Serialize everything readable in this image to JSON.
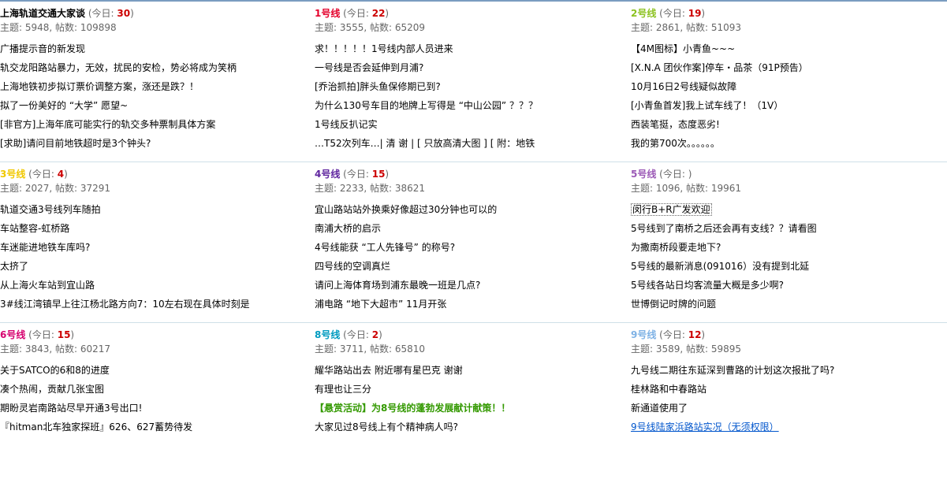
{
  "forums": [
    {
      "name": "上海轨道交通大家谈",
      "name_color": "#000000",
      "today_label": "今日: ",
      "today_count": "30",
      "stats": "主题: 5948, 帖数: 109898",
      "threads": [
        {
          "title": "广播提示音的新发现",
          "style": ""
        },
        {
          "title": "轨交龙阳路站暴力，无效，扰民的安检，势必将成为笑柄",
          "style": ""
        },
        {
          "title": "上海地铁初步拟订票价调整方案，涨还是跌？！",
          "style": ""
        },
        {
          "title": "拟了一份美好的 “大学” 愿望~",
          "style": ""
        },
        {
          "title": "[非官方]上海年底可能实行的轨交多种票制具体方案",
          "style": ""
        },
        {
          "title": "[求助]请问目前地铁超时是3个钟头?",
          "style": ""
        }
      ]
    },
    {
      "name": "1号线",
      "name_color": "#e4002b",
      "today_label": "今日: ",
      "today_count": "22",
      "stats": "主题: 3555, 帖数: 65209",
      "threads": [
        {
          "title": "求！！！！！1号线内部人员进来",
          "style": ""
        },
        {
          "title": "一号线是否会延伸到月浦?",
          "style": ""
        },
        {
          "title": "[乔治抓拍]胖头鱼保修期已到?",
          "style": ""
        },
        {
          "title": "为什么130号车目的地牌上写得是 “中山公园” ？？？",
          "style": ""
        },
        {
          "title": "1号线反扒记实",
          "style": ""
        },
        {
          "title": "…T52次列车…| 清 谢 | [ 只放高清大图 ] [ 附：地铁",
          "style": ""
        }
      ]
    },
    {
      "name": "2号线",
      "name_color": "#8cc220",
      "today_label": "今日: ",
      "today_count": "19",
      "stats": "主题: 2861, 帖数: 51093",
      "threads": [
        {
          "title": "【4M图标】小青鱼~~~",
          "style": ""
        },
        {
          "title": "[X.N.A 团伙作案]停车・品茶（91P预告）",
          "style": ""
        },
        {
          "title": "10月16日2号线疑似故障",
          "style": ""
        },
        {
          "title": "[小青鱼首发]我上试车线了！（1V）",
          "style": ""
        },
        {
          "title": "西装笔挺，态度恶劣!",
          "style": ""
        },
        {
          "title": "我的第700次。。。。。。",
          "style": ""
        }
      ]
    },
    {
      "name": "3号线",
      "name_color": "#f0c800",
      "today_label": "今日: ",
      "today_count": "4",
      "stats": "主题: 2027, 帖数: 37291",
      "threads": [
        {
          "title": "轨道交通3号线列车随拍",
          "style": ""
        },
        {
          "title": "车站整容-虹桥路",
          "style": ""
        },
        {
          "title": "车迷能进地铁车库吗?",
          "style": ""
        },
        {
          "title": "太挤了",
          "style": ""
        },
        {
          "title": "从上海火车站到宜山路",
          "style": ""
        },
        {
          "title": "3#线江湾镇早上往江杨北路方向7：10左右现在具体时刻是",
          "style": ""
        }
      ]
    },
    {
      "name": "4号线",
      "name_color": "#5f259f",
      "today_label": "今日: ",
      "today_count": "15",
      "stats": "主题: 2233, 帖数: 38621",
      "threads": [
        {
          "title": "宜山路站站外换乘好像超过30分钟也可以的",
          "style": ""
        },
        {
          "title": "南浦大桥的启示",
          "style": ""
        },
        {
          "title": "4号线能获 “工人先锋号” 的称号?",
          "style": ""
        },
        {
          "title": "四号线的空调真烂",
          "style": ""
        },
        {
          "title": "请问上海体育场到浦东最晚一班是几点?",
          "style": ""
        },
        {
          "title": "浦电路 “地下大超市” 11月开张",
          "style": ""
        }
      ]
    },
    {
      "name": "5号线",
      "name_color": "#9b59b6",
      "today_label": "今日: ",
      "today_count": "",
      "stats": "主题: 1096, 帖数: 19961",
      "threads": [
        {
          "title": "闵行B+R广发欢迎",
          "style": "boxed"
        },
        {
          "title": "5号线到了南桥之后还会再有支线？？请看图",
          "style": ""
        },
        {
          "title": "为撒南桥段要走地下?",
          "style": ""
        },
        {
          "title": "5号线的最新消息(091016）没有提到北延",
          "style": ""
        },
        {
          "title": "5号线各站日均客流量大概是多少啊?",
          "style": ""
        },
        {
          "title": "世博倒记时牌的问题",
          "style": ""
        }
      ]
    },
    {
      "name": "6号线",
      "name_color": "#d6006f",
      "today_label": "今日: ",
      "today_count": "15",
      "stats": "主题: 3843, 帖数: 60217",
      "threads": [
        {
          "title": "关于SATCO的6和8的进度",
          "style": ""
        },
        {
          "title": "凑个热闹，贡献几张宝图",
          "style": ""
        },
        {
          "title": "期盼灵岩南路站尽早开通3号出口!",
          "style": ""
        },
        {
          "title": "『hitman北车独家探班』626、627蓄势待发",
          "style": ""
        }
      ]
    },
    {
      "name": "8号线",
      "name_color": "#009bc0",
      "today_label": "今日: ",
      "today_count": "2",
      "stats": "主题: 3711, 帖数: 65810",
      "threads": [
        {
          "title": "耀华路站出去 附近哪有星巴克 谢谢",
          "style": ""
        },
        {
          "title": "有理也让三分",
          "style": ""
        },
        {
          "title": "【悬赏活动】为8号线的蓬勃发展献计献策！！",
          "style": "hl"
        },
        {
          "title": "大家见过8号线上有个精神病人吗?",
          "style": ""
        }
      ]
    },
    {
      "name": "9号线",
      "name_color": "#7fb2e5",
      "today_label": "今日: ",
      "today_count": "12",
      "stats": "主题: 3589, 帖数: 59895",
      "threads": [
        {
          "title": "九号线二期往东延深到曹路的计划这次报批了吗?",
          "style": ""
        },
        {
          "title": "桂林路和中春路站",
          "style": ""
        },
        {
          "title": "新通道使用了",
          "style": ""
        },
        {
          "title": "9号线陆家浜路站实况（无须权限）",
          "style": "link"
        }
      ]
    }
  ]
}
